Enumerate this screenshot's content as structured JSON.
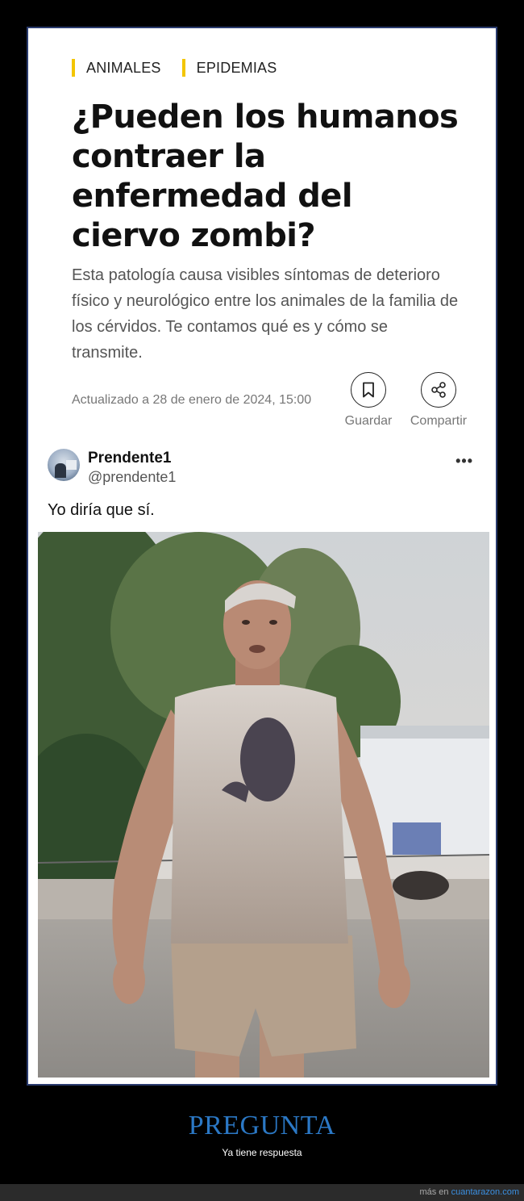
{
  "article": {
    "tags": [
      "ANIMALES",
      "EPIDEMIAS"
    ],
    "title": "¿Pueden los humanos contraer la enfermedad del ciervo zombi?",
    "subtitle": "Esta patología causa visibles síntomas de deterioro físico y neurológico entre los animales de la familia de los cérvidos. Te contamos qué es y cómo se transmite.",
    "date": "Actualizado a 28 de enero de 2024, 15:00",
    "save_label": "Guardar",
    "share_label": "Compartir",
    "accent_color": "#f3c500"
  },
  "tweet": {
    "name": "Prendente1",
    "handle": "@prendente1",
    "more": "•••",
    "text": "Yo diría que sí."
  },
  "site": {
    "caption_title": "PREGUNTA",
    "caption_subtitle": "Ya tiene respuesta",
    "footer_prefix": "más en ",
    "footer_link": "cuantarazon.com",
    "caption_color": "#2b78c5"
  }
}
